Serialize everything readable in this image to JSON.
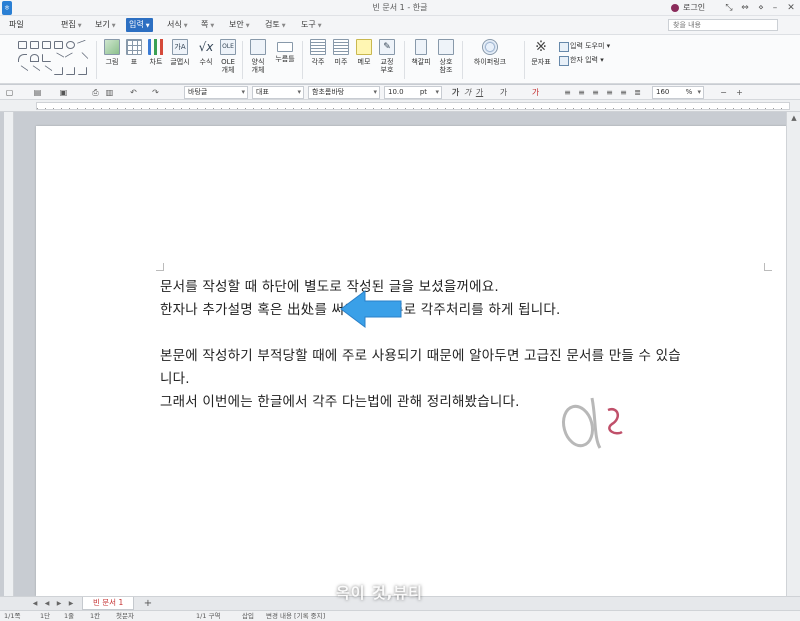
{
  "window": {
    "title": "빈 문서 1 - 한글",
    "login_label": "로그인",
    "help_placeholder": "찾을 내용"
  },
  "menu": {
    "file": "파일",
    "items": [
      {
        "label": "편집"
      },
      {
        "label": "보기"
      },
      {
        "label": "입력",
        "active": true
      },
      {
        "label": "서식"
      },
      {
        "label": "쪽"
      },
      {
        "label": "보안"
      },
      {
        "label": "검토"
      },
      {
        "label": "도구"
      }
    ]
  },
  "ribbon": {
    "buttons": [
      {
        "label": "그림"
      },
      {
        "label": "표"
      },
      {
        "label": "차트"
      },
      {
        "label": "글맵시"
      },
      {
        "label": "수식"
      },
      {
        "label": "OLE\n개체"
      },
      {
        "label": "양식\n개체"
      },
      {
        "label": "누름틀"
      },
      {
        "label": "각주"
      },
      {
        "label": "미주"
      },
      {
        "label": "메모"
      },
      {
        "label": "교정\n부호"
      },
      {
        "label": "책갈피"
      },
      {
        "label": "상호\n참조"
      },
      {
        "label": "하이퍼링크"
      },
      {
        "label": "문자표"
      }
    ],
    "input_helper": "입력 도우미",
    "hanja_input": "한자 입력"
  },
  "format": {
    "style": "바탕글",
    "language": "대표",
    "font": "함초롬바탕",
    "size": "10.0",
    "size_unit": "pt",
    "zoom": "160",
    "zoom_unit": "%"
  },
  "document": {
    "lines": [
      "문서를 작성할 때 하단에 별도로 작성된 글을 보셨을꺼에요.",
      "한자나 추가설명 혹은 出处를 써야할 때 주로 각주처리를 하게 됩니다.",
      "본문에 작성하기 부적당할 때에 주로 사용되기 때문에 알아두면 고급진 문서를 만들 수 있습",
      "니다.",
      "그래서 이번에는 한글에서 각주 다는법에 관해 정리해봤습니다."
    ]
  },
  "tabs": {
    "doc_tab": "빈 문서 1",
    "add": "+"
  },
  "watermark": "옥이 것,뷰티",
  "status": {
    "items": [
      "1/1쪽",
      "1단",
      "1줄",
      "1칸",
      "첫문자",
      "1/1 구역",
      "삽입",
      "변경 내용 [기록 중지]"
    ]
  },
  "colors": {
    "accent": "#2c6fc2",
    "tab_text": "#c53030",
    "arrow": "#3aa0e8"
  }
}
